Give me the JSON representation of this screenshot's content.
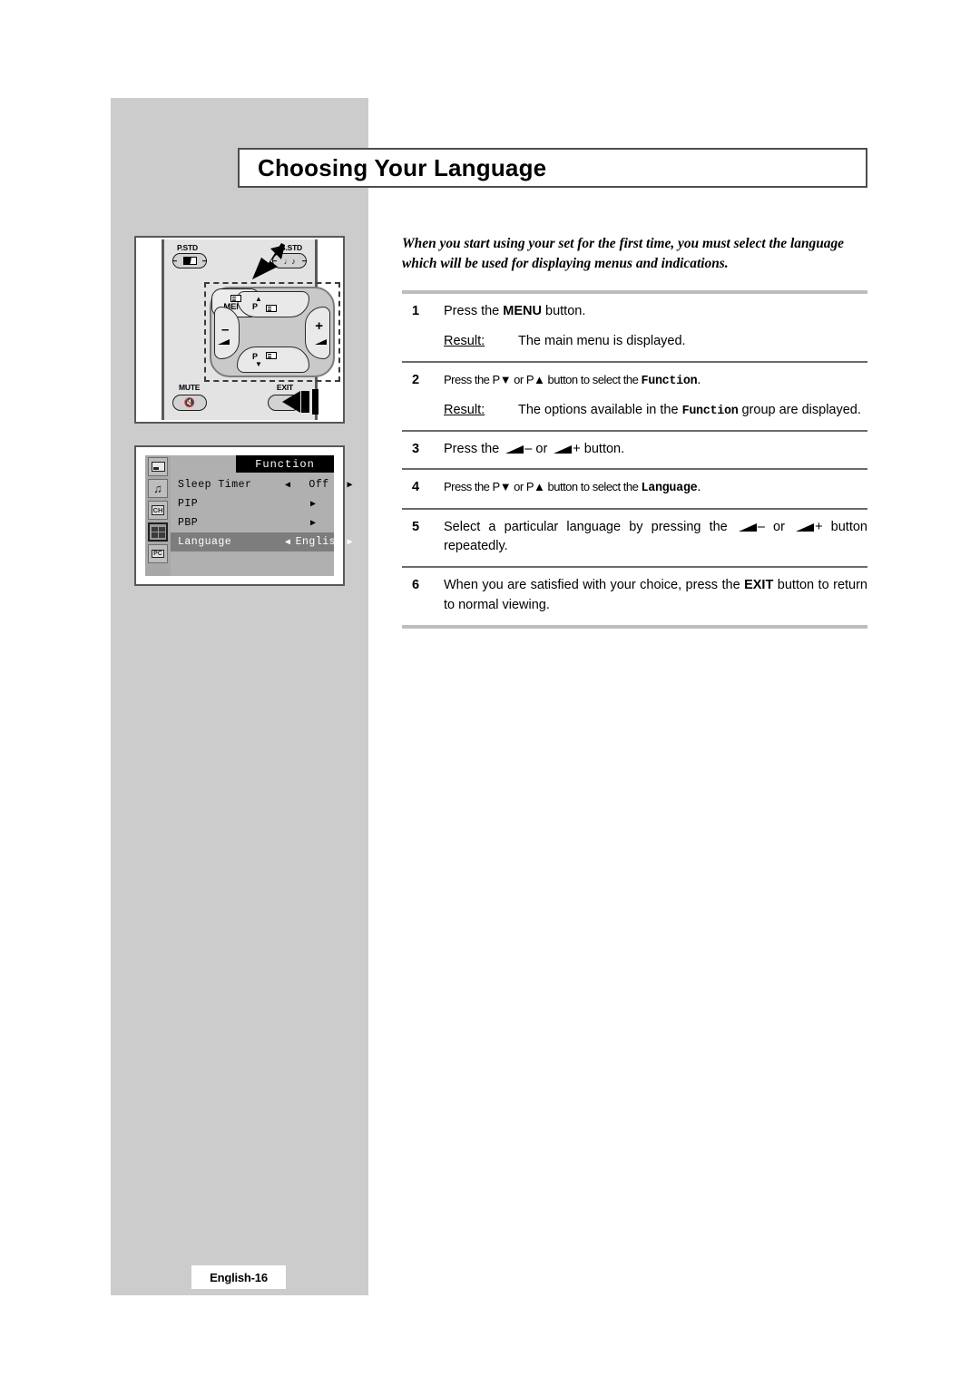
{
  "page": {
    "title": "Choosing Your Language",
    "intro": "When you start using your set for the first time, you must select the language which will be used for displaying menus and indications.",
    "footer_label": "English-16"
  },
  "steps": [
    {
      "number": "1",
      "text_before": "Press the ",
      "bold": "MENU",
      "text_after": " button.",
      "result_label": "Result:",
      "result_text": "The main menu is displayed."
    },
    {
      "number": "2",
      "text_before": "Press the P▼ or P▲ button to select the ",
      "mono": "Function",
      "text_after": ".",
      "result_label": "Result:",
      "result_before": "The options available in the ",
      "result_mono": "Function",
      "result_after": " group are displayed."
    },
    {
      "number": "3",
      "text_before": "Press the ",
      "text_mid": "– or ",
      "text_after": "+ button."
    },
    {
      "number": "4",
      "text_before": "Press the P▼ or P▲ button to select the ",
      "mono": "Language",
      "text_after": "."
    },
    {
      "number": "5",
      "text_before": "Select a particular language by pressing the ",
      "text_mid": "– or ",
      "text_after": "+ button repeatedly."
    },
    {
      "number": "6",
      "text_before": "When you are satisfied with your choice, press the ",
      "bold": "EXIT",
      "text_after": " button to return to normal viewing."
    }
  ],
  "remote": {
    "pstd_label": "P.STD",
    "sstd_label": "S.STD",
    "mute_label": "MUTE",
    "exit_label": "EXIT",
    "menu_label": "MENU",
    "prog_up_label": "P",
    "prog_down_label": "P",
    "vol_down_label": "–",
    "vol_up_label": "+"
  },
  "osd": {
    "title": "Function",
    "rows": [
      {
        "label": "Sleep Timer",
        "value": "Off",
        "type": "value",
        "highlight": false,
        "arrow_left": "◀",
        "arrow_right": "▶"
      },
      {
        "label": "PIP",
        "value": "",
        "type": "submenu",
        "highlight": false,
        "arrow_right": "▶"
      },
      {
        "label": "PBP",
        "value": "",
        "type": "submenu",
        "highlight": false,
        "arrow_right": "▶"
      },
      {
        "label": "Language",
        "value": "English",
        "type": "value",
        "highlight": true,
        "arrow_left": "◀",
        "arrow_right": "▶"
      }
    ],
    "sidebar_icons": [
      {
        "name": "picture-icon",
        "selected": false
      },
      {
        "name": "sound-icon",
        "selected": false
      },
      {
        "name": "channel-icon",
        "selected": false
      },
      {
        "name": "function-icon",
        "selected": true
      },
      {
        "name": "pc-icon",
        "selected": false
      }
    ]
  },
  "colors": {
    "panel_gray": "#cccccc",
    "rule_heavy": "#bdbdbd",
    "rule_thin": "#6b6b6b",
    "osd_bg": "#b0b0b0",
    "osd_highlight": "#7d7d7d",
    "osd_title_bg": "#000000"
  }
}
